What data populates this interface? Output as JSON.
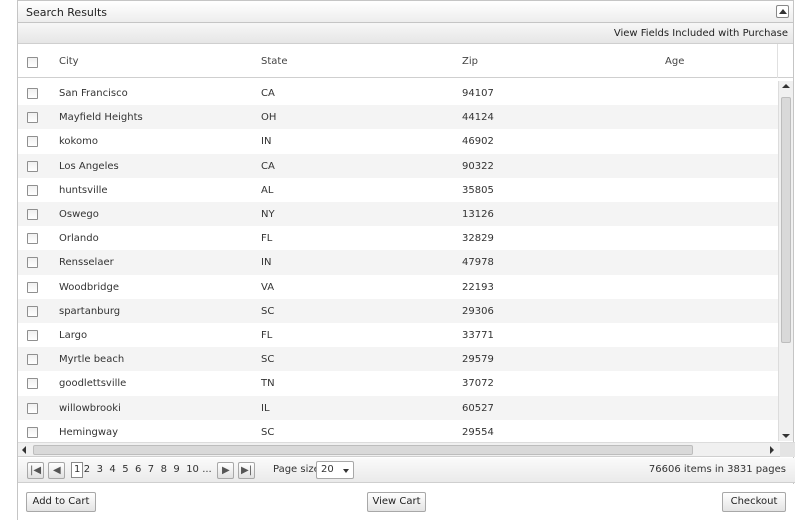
{
  "panel": {
    "title": "Search Results",
    "purchase_link": "View Fields Included with Purchase"
  },
  "columns": [
    "City",
    "State",
    "Zip",
    "Age"
  ],
  "rows": [
    {
      "city": "San Francisco",
      "state": "CA",
      "zip": "94107",
      "age": ""
    },
    {
      "city": "Mayfield Heights",
      "state": "OH",
      "zip": "44124",
      "age": ""
    },
    {
      "city": "kokomo",
      "state": "IN",
      "zip": "46902",
      "age": ""
    },
    {
      "city": "Los Angeles",
      "state": "CA",
      "zip": "90322",
      "age": ""
    },
    {
      "city": "huntsville",
      "state": "AL",
      "zip": "35805",
      "age": ""
    },
    {
      "city": "Oswego",
      "state": "NY",
      "zip": "13126",
      "age": ""
    },
    {
      "city": "Orlando",
      "state": "FL",
      "zip": "32829",
      "age": ""
    },
    {
      "city": "Rensselaer",
      "state": "IN",
      "zip": "47978",
      "age": ""
    },
    {
      "city": "Woodbridge",
      "state": "VA",
      "zip": "22193",
      "age": ""
    },
    {
      "city": "spartanburg",
      "state": "SC",
      "zip": "29306",
      "age": ""
    },
    {
      "city": "Largo",
      "state": "FL",
      "zip": "33771",
      "age": ""
    },
    {
      "city": "Myrtle beach",
      "state": "SC",
      "zip": "29579",
      "age": ""
    },
    {
      "city": "goodlettsville",
      "state": "TN",
      "zip": "37072",
      "age": ""
    },
    {
      "city": "willowbrooki",
      "state": "IL",
      "zip": "60527",
      "age": ""
    },
    {
      "city": "Hemingway",
      "state": "SC",
      "zip": "29554",
      "age": ""
    }
  ],
  "pager": {
    "pages": [
      "1",
      "2",
      "3",
      "4",
      "5",
      "6",
      "7",
      "8",
      "9",
      "10",
      "..."
    ],
    "current_page": "1",
    "page_size_label": "Page size:",
    "page_size_value": "20",
    "info": "76606 items in 3831 pages"
  },
  "buttons": {
    "add_to_cart": "Add to Cart",
    "view_cart": "View Cart",
    "checkout": "Checkout"
  }
}
